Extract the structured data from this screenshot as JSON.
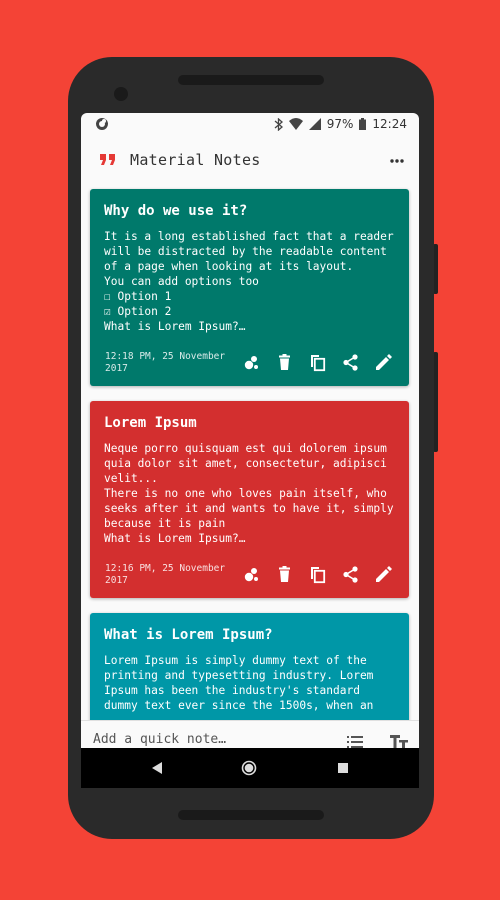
{
  "status_bar": {
    "battery": "97%",
    "time": "12:24"
  },
  "app": {
    "title": "Material Notes"
  },
  "notes": [
    {
      "title": "Why do we use it?",
      "body": "It is a long established fact that a reader\nwill be distracted by the readable content\nof a page when looking at its layout.\nYou can add options too\n☐ Option 1\n☑ Option 2\nWhat is Lorem Ipsum?…",
      "timestamp": "12:18 PM, 25 November\n2017",
      "color": "#00796b"
    },
    {
      "title": "Lorem Ipsum",
      "body": "Neque porro quisquam est qui dolorem ipsum\nquia dolor sit amet, consectetur, adipisci\nvelit...\nThere is no one who loves pain itself, who\nseeks after it and wants to have it, simply\nbecause it is pain\nWhat is Lorem Ipsum?…",
      "timestamp": "12:16 PM, 25 November\n2017",
      "color": "#d32f2f"
    },
    {
      "title": "What is Lorem Ipsum?",
      "body": "Lorem Ipsum is simply dummy text of the\nprinting and typesetting industry. Lorem\nIpsum has been the industry's standard\ndummy text ever since the 1500s, when an",
      "timestamp": "",
      "color": "#0097a7"
    }
  ],
  "note_actions": [
    "color-palette-icon",
    "delete-icon",
    "copy-icon",
    "share-icon",
    "edit-icon"
  ],
  "quick_note": {
    "placeholder": "Add a quick note…"
  },
  "colors": {
    "background": "#f44336",
    "accent": "#d32f2f"
  }
}
